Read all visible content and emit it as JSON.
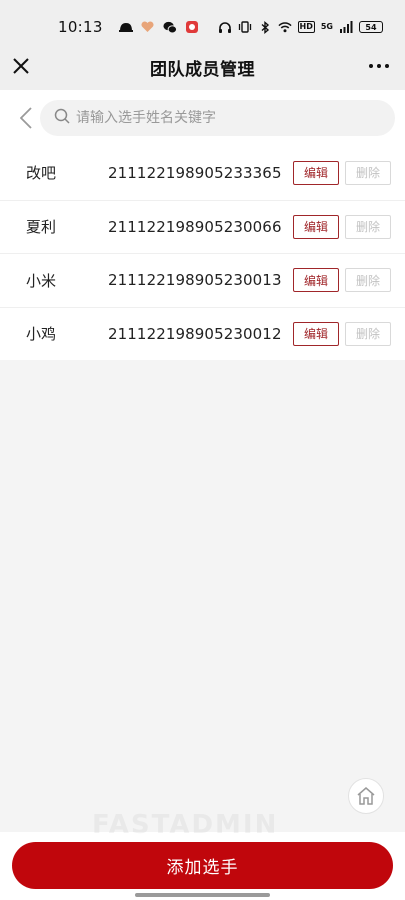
{
  "status_bar": {
    "time": "10:13",
    "network": "5G",
    "hd": "HD",
    "battery": "54"
  },
  "nav": {
    "title": "团队成员管理"
  },
  "search": {
    "placeholder": "请输入选手姓名关键字",
    "value": ""
  },
  "members": [
    {
      "name": "改吧",
      "id_number": "211122198905233365",
      "edit_label": "编辑",
      "delete_label": "删除"
    },
    {
      "name": "夏利",
      "id_number": "211122198905230066",
      "edit_label": "编辑",
      "delete_label": "删除"
    },
    {
      "name": "小米",
      "id_number": "211122198905230013",
      "edit_label": "编辑",
      "delete_label": "删除"
    },
    {
      "name": "小鸡",
      "id_number": "211122198905230012",
      "edit_label": "编辑",
      "delete_label": "删除"
    }
  ],
  "watermark": "FASTADMIN",
  "add_button": {
    "label": "添加选手"
  },
  "colors": {
    "accent": "#c0060c",
    "edit_border": "#a0262a",
    "disabled": "#c2c2c2"
  }
}
